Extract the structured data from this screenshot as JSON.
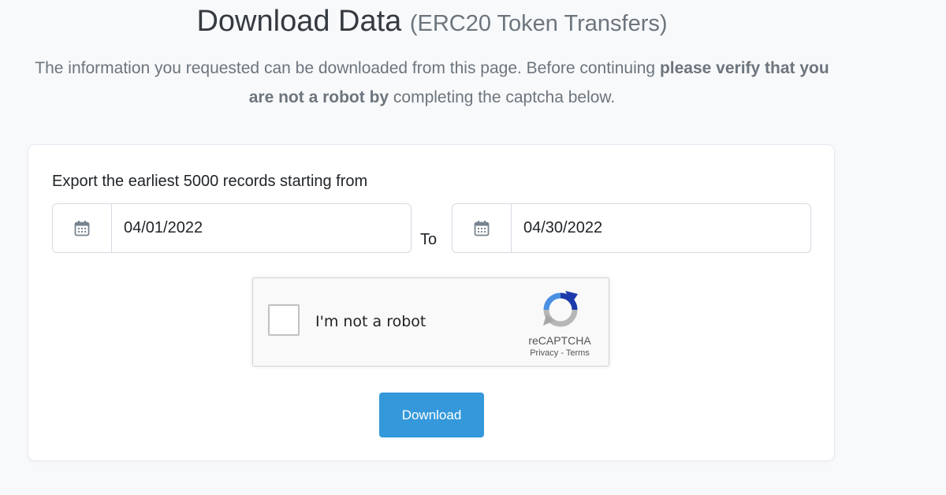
{
  "header": {
    "title": "Download Data",
    "subtitle": "(ERC20 Token Transfers)"
  },
  "intro": {
    "text_before": "The information you requested can be downloaded from this page. Before continuing ",
    "text_bold": "please verify that you are not a robot by",
    "text_after": " completing the captcha below."
  },
  "form": {
    "export_label": "Export the earliest 5000 records starting from",
    "start_date": "04/01/2022",
    "to_label": "To",
    "end_date": "04/30/2022",
    "calendar_icon": "calendar-icon"
  },
  "captcha": {
    "label": "I'm not a robot",
    "brand": "reCAPTCHA",
    "privacy": "Privacy",
    "separator": "-",
    "terms": "Terms"
  },
  "actions": {
    "download_label": "Download"
  },
  "footer": {
    "note": ""
  },
  "colors": {
    "accent": "#3498db",
    "background": "#f8f9fa"
  }
}
